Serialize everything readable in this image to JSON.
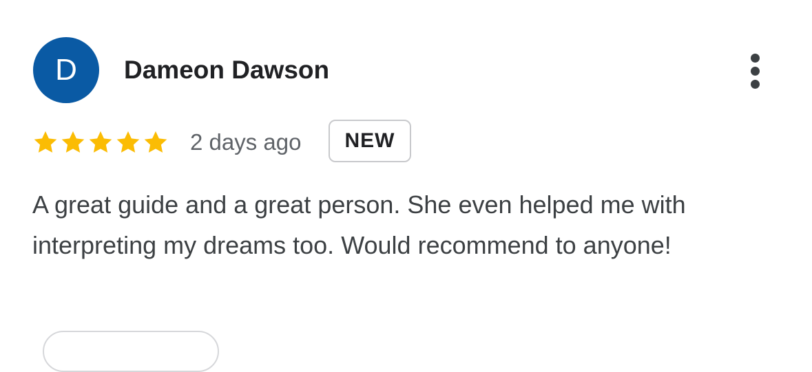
{
  "review": {
    "author_initial": "D",
    "author_name": "Dameon Dawson",
    "avatar_color": "#0a5aa4",
    "rating": 5,
    "rating_max": 5,
    "star_color": "#fbbc04",
    "time_ago": "2 days ago",
    "badge": "NEW",
    "text": "A great guide and a great person. She even helped me with interpreting my dreams too. Would recommend to anyone!",
    "more_icon": "more-vert-icon"
  }
}
